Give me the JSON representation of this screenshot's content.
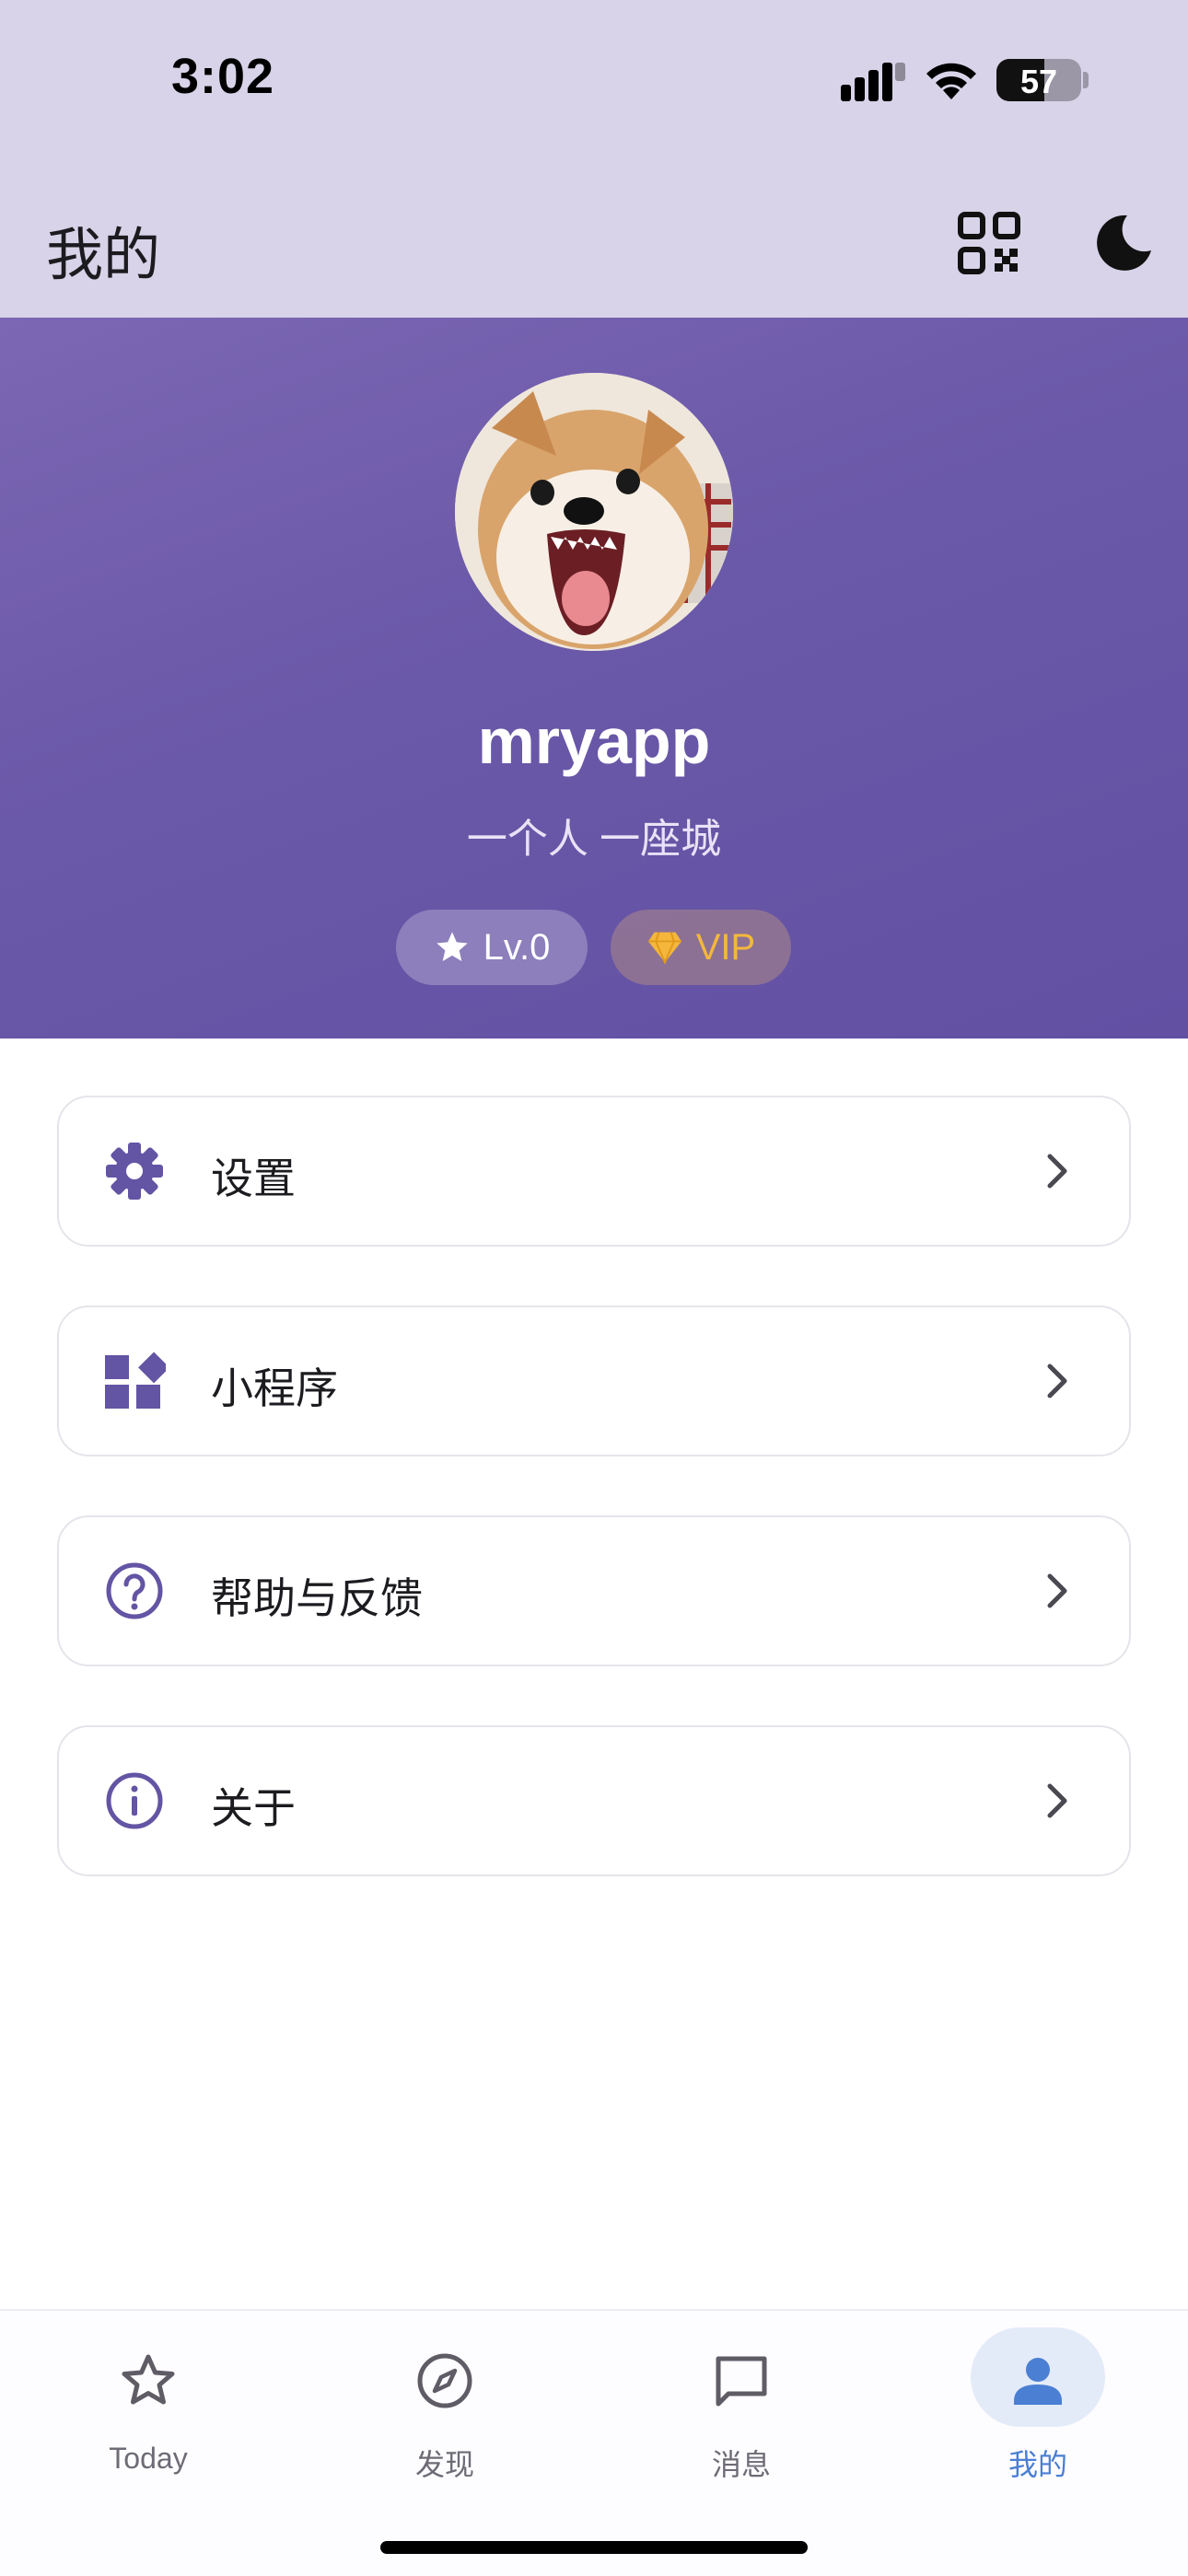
{
  "status_bar": {
    "time": "3:02",
    "battery_percent": "57",
    "battery_level": 0.57
  },
  "appbar": {
    "title": "我的",
    "icons": [
      "qr-code-icon",
      "moon-icon"
    ]
  },
  "profile": {
    "username": "mryapp",
    "bio": "一个人 一座城",
    "level_badge": "Lv.0",
    "vip_badge": "VIP",
    "badge_colors": {
      "vip_text": "#f4b73c",
      "hero": "#6a58a8"
    }
  },
  "menu": {
    "items": [
      {
        "label": "设置",
        "icon": "settings-gear-icon"
      },
      {
        "label": "小程序",
        "icon": "widgets-icon"
      },
      {
        "label": "帮助与反馈",
        "icon": "help-circle-icon"
      },
      {
        "label": "关于",
        "icon": "info-circle-icon"
      }
    ]
  },
  "bottom_nav": {
    "items": [
      {
        "label": "Today",
        "icon": "star-icon",
        "active": false
      },
      {
        "label": "发现",
        "icon": "compass-icon",
        "active": false
      },
      {
        "label": "消息",
        "icon": "message-icon",
        "active": false
      },
      {
        "label": "我的",
        "icon": "person-icon",
        "active": true
      }
    ],
    "active_color": "#4a7fd4"
  }
}
